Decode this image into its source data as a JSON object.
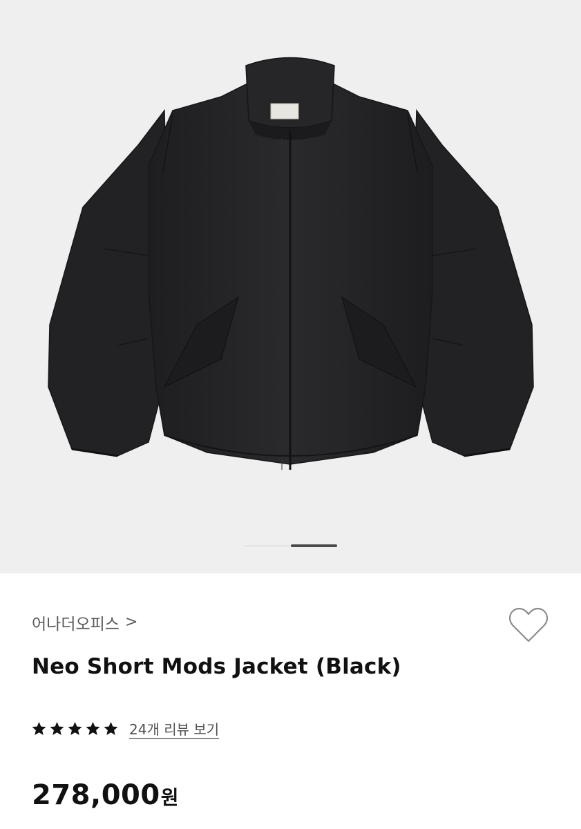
{
  "product_image": {
    "alt_icon": "jacket-photo",
    "background": "#efeff0",
    "slide_index": 2,
    "slide_count": 2
  },
  "brand": {
    "name": "어나더오피스",
    "chevron": ">"
  },
  "wishlist": {
    "icon": "heart-icon"
  },
  "product": {
    "title": "Neo Short Mods Jacket (Black)",
    "rating": 5,
    "rating_max": 5,
    "review_link": "24개 리뷰 보기",
    "price": "278,000",
    "currency": "원"
  }
}
